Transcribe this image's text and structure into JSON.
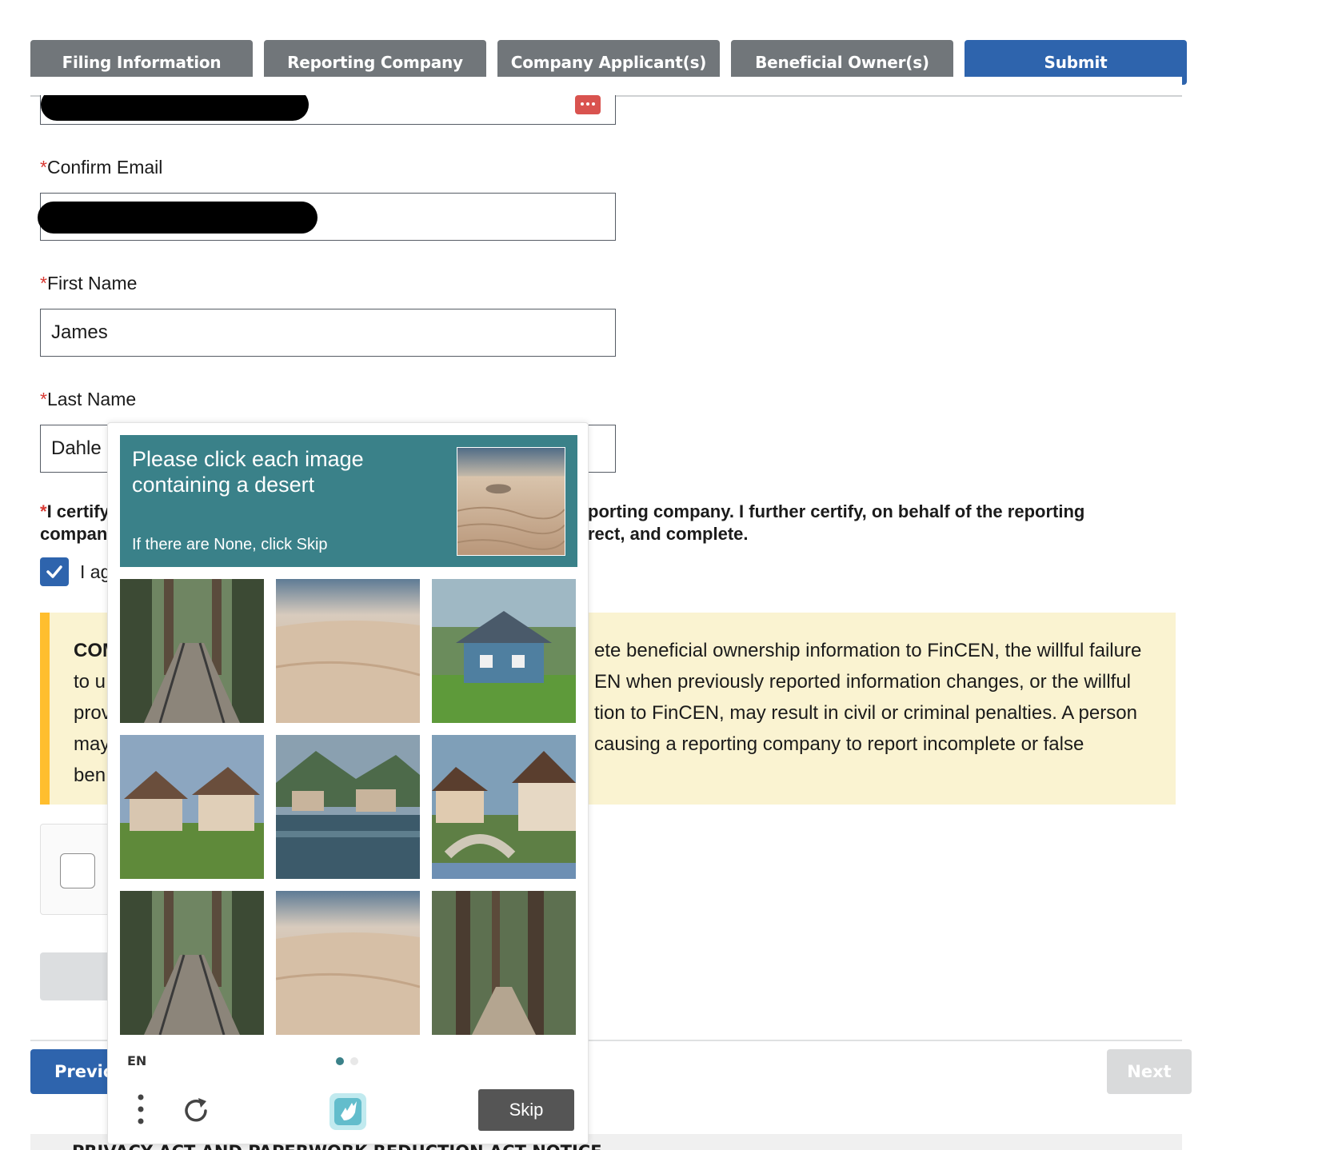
{
  "tabs": [
    {
      "label": "Filing Information"
    },
    {
      "label": "Reporting Company"
    },
    {
      "label": "Company Applicant(s)"
    },
    {
      "label": "Beneficial Owner(s)"
    },
    {
      "label": "Submit",
      "active": true
    }
  ],
  "form": {
    "required_mark": "*",
    "confirm_email_label": "Confirm Email",
    "first_name_label": "First Name",
    "first_name_value": "James",
    "last_name_label": "Last Name",
    "last_name_value": "Dahle",
    "certify_line1_start": "I certify",
    "certify_line1_end": "porting company. I further certify, on behalf of the reporting",
    "certify_line2_start": "compan",
    "certify_line2_end": "rect, and complete.",
    "agree_partial": "I ag",
    "agree_checked": true
  },
  "compliance": {
    "lines_left": [
      "COM",
      "to u",
      "prov",
      "may",
      "ben"
    ],
    "lines_right": [
      "ete beneficial ownership information to FinCEN, the willful failure",
      "EN when previously reported information changes, or the willful",
      "tion to FinCEN, may result in civil or criminal penalties. A person",
      "causing a reporting company to report incomplete or false",
      ""
    ]
  },
  "navigation": {
    "previous_partial": "Previo",
    "next": "Next"
  },
  "privacy_notice": "PRIVACY ACT AND PAPERWORK REDUCTION ACT NOTICE",
  "captcha": {
    "prompt": "Please click each image containing a desert",
    "sub": "If there are None, click Skip",
    "language": "EN",
    "skip": "Skip",
    "tiles": [
      "railway-forest",
      "desert",
      "cottage",
      "village",
      "lake-village",
      "village-bridge",
      "railway-forest",
      "desert",
      "forest-path"
    ],
    "page_current": 1,
    "page_total": 2
  },
  "colors": {
    "tab_inactive": "#71767a",
    "tab_active": "#2e64ad",
    "captcha_header": "#3a8189",
    "compliance_bg": "#faf3d1",
    "compliance_border": "#ffbe2e"
  }
}
